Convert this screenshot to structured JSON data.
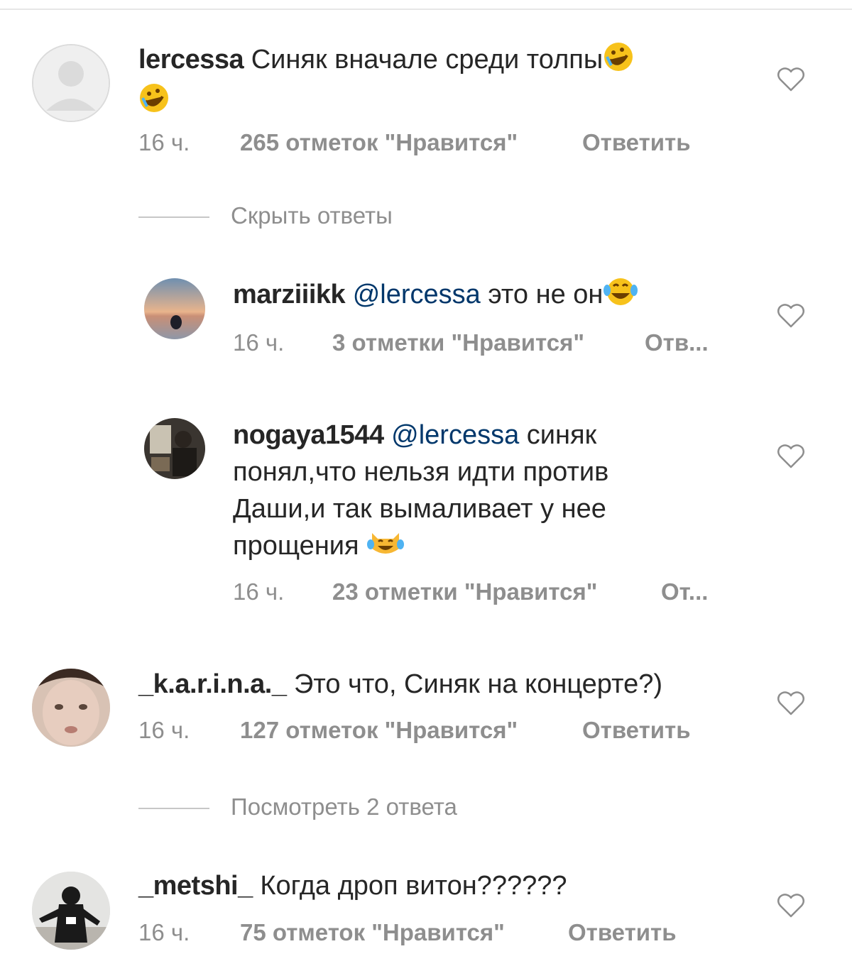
{
  "comments": [
    {
      "username": "lercessa",
      "text_line1": "Синяк вначале среди толпы",
      "time": "16 ч.",
      "likes": "265 отметок \"Нравится\"",
      "reply": "Ответить"
    },
    {
      "username": "marziiikk",
      "mention": "@lercessa",
      "text": "это не он",
      "time": "16 ч.",
      "likes": "3 отметки \"Нравится\"",
      "reply": "Отв..."
    },
    {
      "username": "nogaya1544",
      "mention": "@lercessa",
      "text_line1": "синяк",
      "text_line2": "понял,что нельзя идти против",
      "text_line3": "Даши,и так вымаливает у нее",
      "text_line4": "прощения",
      "time": "16 ч.",
      "likes": "23 отметки \"Нравится\"",
      "reply": "От..."
    },
    {
      "username": "_k.a.r.i.n.a._",
      "text": "Это что, Синяк на концерте?)",
      "time": "16 ч.",
      "likes": "127 отметок \"Нравится\"",
      "reply": "Ответить"
    },
    {
      "username": "_metshi_",
      "text": "Когда дроп витон??????",
      "time": "16 ч.",
      "likes": "75 отметок \"Нравится\"",
      "reply": "Ответить"
    }
  ],
  "toggles": {
    "hide_replies": "Скрыть ответы",
    "view_replies": "Посмотреть 2 ответа"
  },
  "icons": {
    "like": "heart-outline-icon",
    "emoji_laugh_rolling": "rolling-on-floor-laughing-emoji",
    "emoji_tears_joy": "face-with-tears-of-joy-emoji",
    "emoji_cat_joy": "cat-with-tears-of-joy-emoji"
  },
  "colors": {
    "text": "#262626",
    "secondary": "#8e8e8e",
    "mention": "#00376b"
  }
}
